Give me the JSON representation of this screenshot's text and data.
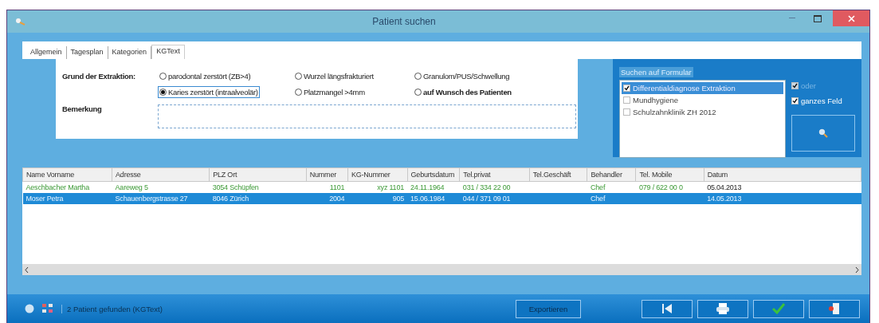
{
  "window": {
    "title": "Patient suchen"
  },
  "tabs": [
    {
      "label": "Allgemein",
      "selected": false
    },
    {
      "label": "Tagesplan",
      "selected": false
    },
    {
      "label": "Kategorien",
      "selected": false
    },
    {
      "label": "KGText",
      "selected": true
    }
  ],
  "form": {
    "reason_label": "Grund der Extraktion:",
    "remark_label": "Bemerkung",
    "options": [
      {
        "label": "parodontal zerstört (ZB>4)",
        "selected": false,
        "bold": false
      },
      {
        "label": "Wurzel längsfrakturiert",
        "selected": false,
        "bold": false
      },
      {
        "label": "Granulom/PUS/Schwellung",
        "selected": false,
        "bold": false
      },
      {
        "label": "Karies zerstört (intraalveolär)",
        "selected": true,
        "bold": false
      },
      {
        "label": "Platzmangel >4mm",
        "selected": false,
        "bold": false
      },
      {
        "label": "auf Wunsch des Patienten",
        "selected": false,
        "bold": true
      }
    ]
  },
  "search_panel": {
    "title": "Suchen auf Formular",
    "forms": [
      {
        "label": "Differentialdiagnose Extraktion",
        "checked": true,
        "selected": true
      },
      {
        "label": "Mundhygiene",
        "checked": false,
        "selected": false
      },
      {
        "label": "Schulzahnklinik ZH 2012",
        "checked": false,
        "selected": false
      }
    ],
    "options": [
      {
        "label": "oder",
        "checked": true,
        "disabled": true
      },
      {
        "label": "ganzes Feld",
        "checked": true,
        "disabled": false
      }
    ]
  },
  "table": {
    "columns": [
      {
        "label": "Name Vorname",
        "kind": "text"
      },
      {
        "label": "Adresse",
        "kind": "text"
      },
      {
        "label": "PLZ Ort",
        "kind": "text"
      },
      {
        "label": "Nummer",
        "kind": "num"
      },
      {
        "label": "KG-Nummer",
        "kind": "num"
      },
      {
        "label": "Geburtsdatum",
        "kind": "text"
      },
      {
        "label": "Tel.privat",
        "kind": "text"
      },
      {
        "label": "Tel.Geschäft",
        "kind": "text"
      },
      {
        "label": "Behandler",
        "kind": "text"
      },
      {
        "label": "Tel. Mobile",
        "kind": "text"
      },
      {
        "label": "Datum",
        "kind": "date"
      }
    ],
    "rows": [
      {
        "selected": false,
        "highlighted": true,
        "cells": [
          "Aeschbacher Martha",
          "Aareweg 5",
          "3054 Schüpfen",
          "1101",
          "xyz 1101",
          "24.11.1964",
          "031 / 334 22 00",
          null,
          "Chef",
          "079 / 622 00 0",
          "05.04.2013"
        ]
      },
      {
        "selected": true,
        "highlighted": false,
        "cells": [
          "Moser Petra",
          "Schauenbergstrasse 27",
          "8046 Zürich",
          "2004",
          "905",
          "15.06.1984",
          "044 / 371 09 01",
          null,
          "Chef",
          null,
          "14.05.2013"
        ]
      }
    ]
  },
  "status_bar": {
    "text": "2 Patient gefunden (KGText)"
  },
  "buttons": [
    {
      "kind": "text",
      "label": "Exportieren"
    },
    {
      "kind": "first"
    },
    {
      "kind": "print"
    },
    {
      "kind": "ok"
    },
    {
      "kind": "exit"
    }
  ]
}
